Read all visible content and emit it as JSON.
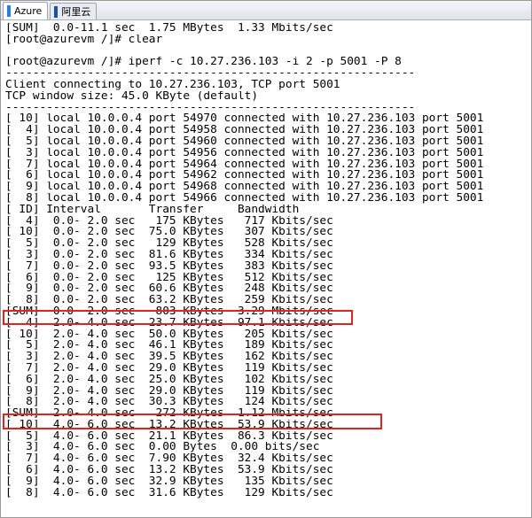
{
  "tabs": [
    {
      "label": "Azure",
      "active": true,
      "icon_color": "#2a7de1"
    },
    {
      "label": "阿里云",
      "active": false,
      "icon_color": "#1e4fa8"
    }
  ],
  "highlight_color": "#e02424",
  "terminal": {
    "lines": [
      "[SUM]  0.0-11.1 sec  1.75 MBytes  1.33 Mbits/sec",
      "[root@azurevm /]# clear",
      "",
      "[root@azurevm /]# iperf -c 10.27.236.103 -i 2 -p 5001 -P 8",
      "------------------------------------------------------------",
      "Client connecting to 10.27.236.103, TCP port 5001",
      "TCP window size: 45.0 KByte (default)",
      "------------------------------------------------------------",
      "[ 10] local 10.0.0.4 port 54970 connected with 10.27.236.103 port 5001",
      "[  4] local 10.0.0.4 port 54958 connected with 10.27.236.103 port 5001",
      "[  5] local 10.0.0.4 port 54960 connected with 10.27.236.103 port 5001",
      "[  3] local 10.0.0.4 port 54956 connected with 10.27.236.103 port 5001",
      "[  7] local 10.0.0.4 port 54964 connected with 10.27.236.103 port 5001",
      "[  6] local 10.0.0.4 port 54962 connected with 10.27.236.103 port 5001",
      "[  9] local 10.0.0.4 port 54968 connected with 10.27.236.103 port 5001",
      "[  8] local 10.0.0.4 port 54966 connected with 10.27.236.103 port 5001",
      "[ ID] Interval       Transfer     Bandwidth",
      "[  4]  0.0- 2.0 sec   175 KBytes   717 Kbits/sec",
      "[ 10]  0.0- 2.0 sec  75.0 KBytes   307 Kbits/sec",
      "[  5]  0.0- 2.0 sec   129 KBytes   528 Kbits/sec",
      "[  3]  0.0- 2.0 sec  81.6 KBytes   334 Kbits/sec",
      "[  7]  0.0- 2.0 sec  93.5 KBytes   383 Kbits/sec",
      "[  6]  0.0- 2.0 sec   125 KBytes   512 Kbits/sec",
      "[  9]  0.0- 2.0 sec  60.6 KBytes   248 Kbits/sec",
      "[  8]  0.0- 2.0 sec  63.2 KBytes   259 Kbits/sec",
      "[SUM]  0.0- 2.0 sec   803 KBytes  3.29 Mbits/sec",
      "[  4]  2.0- 4.0 sec  23.7 KBytes  97.1 Kbits/sec",
      "[ 10]  2.0- 4.0 sec  50.0 KBytes   205 Kbits/sec",
      "[  5]  2.0- 4.0 sec  46.1 KBytes   189 Kbits/sec",
      "[  3]  2.0- 4.0 sec  39.5 KBytes   162 Kbits/sec",
      "[  7]  2.0- 4.0 sec  29.0 KBytes   119 Kbits/sec",
      "[  6]  2.0- 4.0 sec  25.0 KBytes   102 Kbits/sec",
      "[  9]  2.0- 4.0 sec  29.0 KBytes   119 Kbits/sec",
      "[  8]  2.0- 4.0 sec  30.3 KBytes   124 Kbits/sec",
      "[SUM]  2.0- 4.0 sec   272 KBytes  1.12 Mbits/sec",
      "[ 10]  4.0- 6.0 sec  13.2 KBytes  53.9 Kbits/sec",
      "[  5]  4.0- 6.0 sec  21.1 KBytes  86.3 Kbits/sec",
      "[  3]  4.0- 6.0 sec  0.00 Bytes  0.00 bits/sec",
      "[  7]  4.0- 6.0 sec  7.90 KBytes  32.4 Kbits/sec",
      "[  6]  4.0- 6.0 sec  13.2 KBytes  53.9 Kbits/sec",
      "[  9]  4.0- 6.0 sec  32.9 KBytes   135 Kbits/sec",
      "[  8]  4.0- 6.0 sec  31.6 KBytes   129 Kbits/sec"
    ]
  }
}
